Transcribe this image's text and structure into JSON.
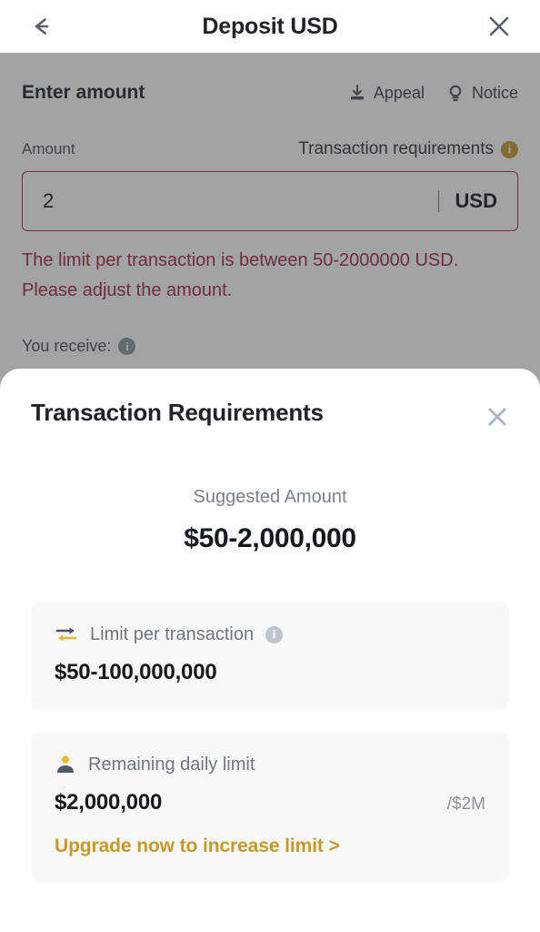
{
  "navbar": {
    "back_icon": "arrow-left-icon",
    "title": "Deposit USD",
    "close_icon": "close-icon"
  },
  "background_page": {
    "section_title": "Enter amount",
    "actions": [
      {
        "label": "Appeal",
        "icon": "inbox-download-icon"
      },
      {
        "label": "Notice",
        "icon": "lightbulb-icon"
      }
    ],
    "amount_label": "Amount",
    "transaction_requirements_link": "Transaction requirements",
    "transaction_requirements_icon": "info-icon",
    "amount_value": "2",
    "amount_placeholder": "0",
    "currency": "USD",
    "error_message": "The limit per transaction is between 50-2000000 USD. Please adjust the amount.",
    "you_receive_label": "You receive:",
    "you_receive_icon": "info-icon"
  },
  "sheet": {
    "title": "Transaction Requirements",
    "close_icon": "close-icon",
    "suggested": {
      "label": "Suggested Amount",
      "value": "$50-2,000,000"
    },
    "cards": [
      {
        "icon": "exchange-arrows-icon",
        "label": "Limit per transaction",
        "info_icon": "info-icon",
        "value": "$50-100,000,000",
        "suffix": "",
        "link": ""
      },
      {
        "icon": "user-icon",
        "label": "Remaining daily limit",
        "info_icon": "",
        "value": "$2,000,000",
        "suffix": "/$2M",
        "link": "Upgrade now to increase limit >"
      }
    ]
  },
  "colors": {
    "accent_gold": "#c59a2a",
    "error_red": "#a6263d",
    "input_border_red": "#b32a42",
    "text_primary": "#15181d",
    "text_muted": "#7b818c",
    "card_bg": "#f7f8f9",
    "scrim": "rgba(51,54,58,0.46)"
  }
}
